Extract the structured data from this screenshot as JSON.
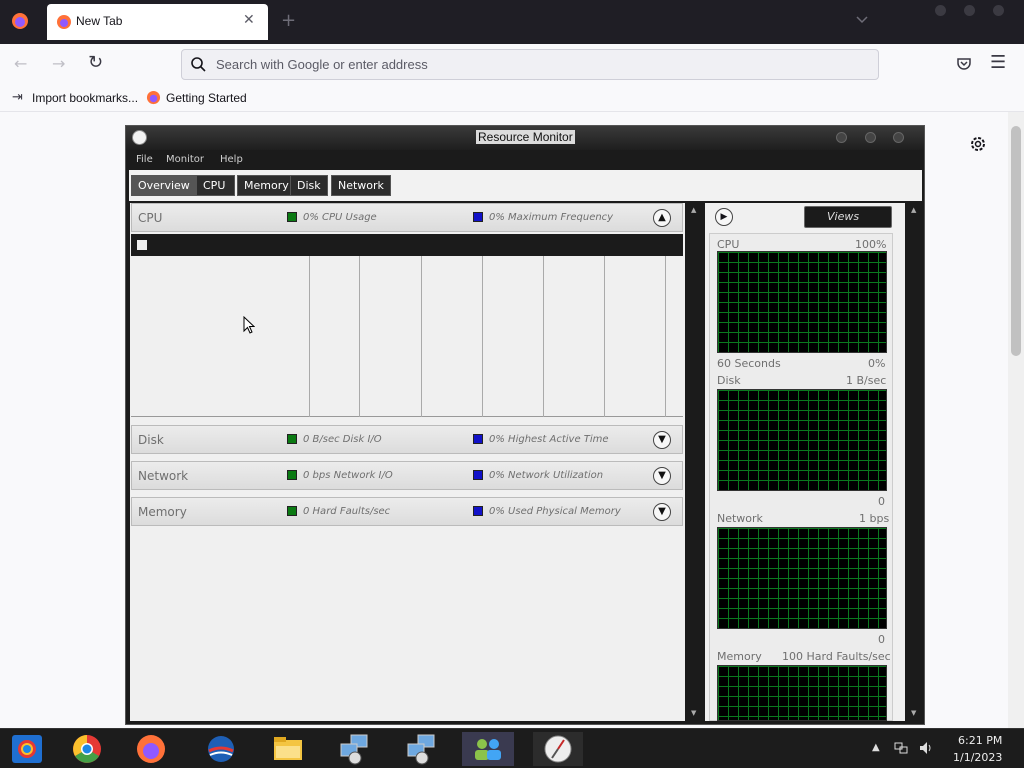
{
  "browser": {
    "tab_title": "New Tab",
    "url_placeholder": "Search with Google or enter address",
    "bookmarks": [
      "Import bookmarks...",
      "Getting Started"
    ]
  },
  "window": {
    "title": "Resource Monitor",
    "menu": [
      "File",
      "Monitor",
      "Help"
    ],
    "tabs": [
      "Overview",
      "CPU",
      "Memory",
      "Disk",
      "Network"
    ],
    "active_tab": "Overview"
  },
  "sections": [
    {
      "title": "CPU",
      "stat1": "0% CPU Usage",
      "stat2": "0% Maximum Frequency",
      "expanded": true
    },
    {
      "title": "Disk",
      "stat1": "0 B/sec Disk I/O",
      "stat2": "0% Highest Active Time",
      "expanded": false
    },
    {
      "title": "Network",
      "stat1": "0 bps Network I/O",
      "stat2": "0% Network Utilization",
      "expanded": false
    },
    {
      "title": "Memory",
      "stat1": "0 Hard Faults/sec",
      "stat2": "0% Used Physical Memory",
      "expanded": false
    }
  ],
  "graphs": {
    "views_label": "Views",
    "cpu": {
      "label": "CPU",
      "max": "100%",
      "time": "60 Seconds",
      "min": "0%"
    },
    "disk": {
      "label": "Disk",
      "max": "1 B/sec",
      "min": "0"
    },
    "network": {
      "label": "Network",
      "max": "1 bps",
      "min": "0"
    },
    "memory": {
      "label": "Memory",
      "max": "100 Hard Faults/sec"
    }
  },
  "colors": {
    "legend_green": "#0b7a13",
    "legend_blue": "#1212c8",
    "graph_grid": "#0a7a1e"
  },
  "taskbar": {
    "apps": [
      "chrome-icon",
      "chrome-icon",
      "firefox-icon",
      "browser-icon",
      "file-explorer-icon",
      "network-tool-icon",
      "network-tool-icon",
      "users-icon",
      "resource-monitor-icon"
    ],
    "time": "6:21 PM",
    "date": "1/1/2023"
  }
}
